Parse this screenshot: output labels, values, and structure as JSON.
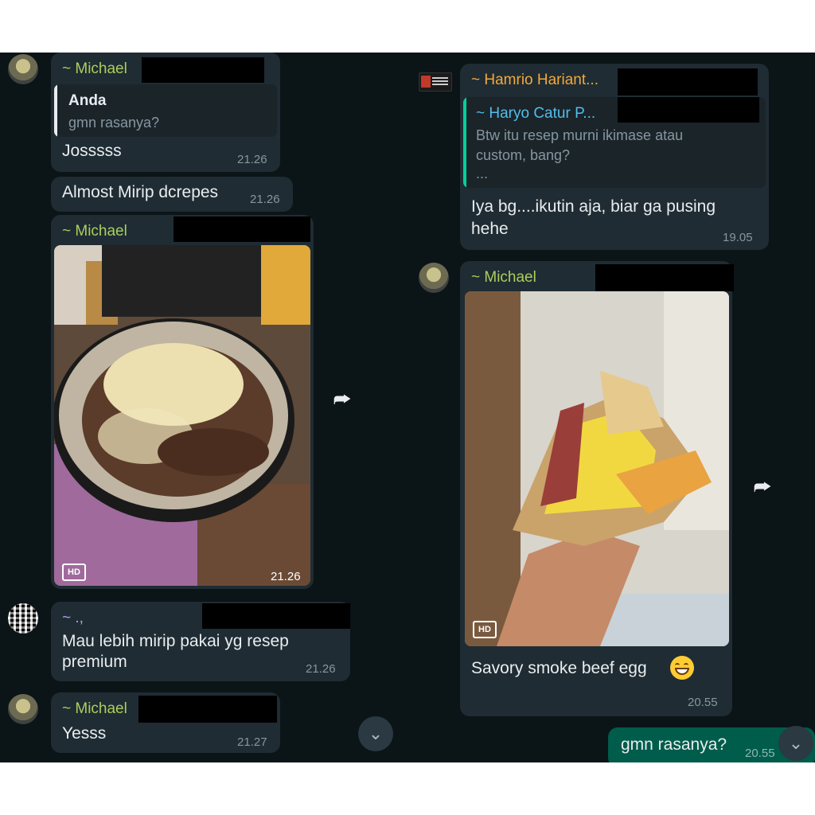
{
  "colors": {
    "background": "#0b1417",
    "bubble_in": "#1f2c33",
    "bubble_out": "#005c4b",
    "michael": "#a9cf5c",
    "hamrio": "#f2a93b",
    "haryo": "#53bdeb",
    "unknown_sender": "#b49cf0"
  },
  "left": {
    "messages": [
      {
        "sender": "~ Michael",
        "quote": {
          "author": "Anda",
          "text": "gmn rasanya?"
        },
        "text": "Josssss",
        "time": "21.26"
      },
      {
        "text": "Almost Mirip dcrepes",
        "time": "21.26"
      },
      {
        "sender": "~ Michael",
        "image": "crepe-with-chocolate-and-cheese-photo",
        "hd": "HD",
        "time": "21.26"
      },
      {
        "sender": "~ .,",
        "text_line1": "Mau lebih mirip pakai yg resep",
        "text_line2": "premium",
        "time": "21.26"
      },
      {
        "sender": "~ Michael",
        "text": "Yesss",
        "time": "21.27"
      }
    ]
  },
  "right": {
    "messages": [
      {
        "sender": "~ Hamrio Hariant...",
        "quote": {
          "author": "~ Haryo Catur P...",
          "text_line1": "Btw itu resep murni ikimase atau",
          "text_line2": "custom, bang?",
          "text_line3": "..."
        },
        "text_line1": "Iya bg....ikutin aja, biar ga pusing",
        "text_line2": "hehe",
        "time": "19.05"
      },
      {
        "sender": "~ Michael",
        "image": "savory-crepe-in-hand-photo",
        "hd": "HD",
        "text": "Savory smoke beef egg",
        "emoji": "grinning-face-emoji",
        "time": "20.55"
      },
      {
        "text": "gmn rasanya?",
        "time": "20.55",
        "outgoing": true
      }
    ]
  },
  "icons": {
    "forward": "forward-icon",
    "scroll_down": "double-chevron-down-icon"
  }
}
